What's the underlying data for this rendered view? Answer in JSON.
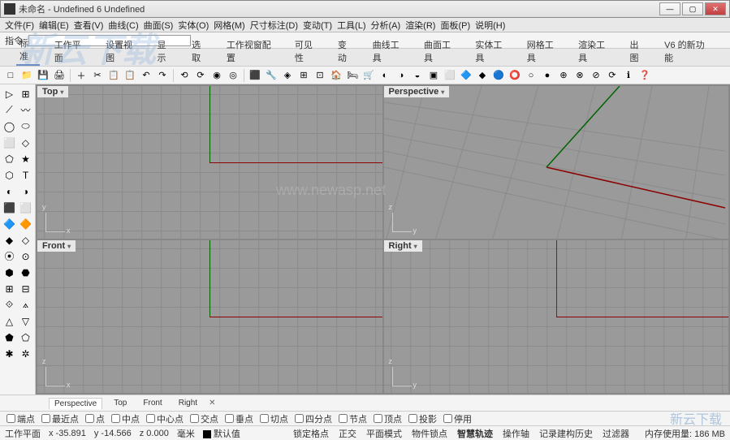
{
  "title": "未命名 - Undefined 6 Undefined",
  "menubar": [
    "文件(F)",
    "编辑(E)",
    "查看(V)",
    "曲线(C)",
    "曲面(S)",
    "实体(O)",
    "网格(M)",
    "尺寸标注(D)",
    "变动(T)",
    "工具(L)",
    "分析(A)",
    "渲染(R)",
    "面板(P)",
    "说明(H)"
  ],
  "command_label": "指令:",
  "tabs": [
    "标准",
    "工作平面",
    "设置视图",
    "显示",
    "选取",
    "工作视窗配置",
    "可见性",
    "变动",
    "曲线工具",
    "曲面工具",
    "实体工具",
    "网格工具",
    "渲染工具",
    "出图",
    "V6 的新功能"
  ],
  "active_tab": 0,
  "toolbar_icons": [
    "□",
    "📁",
    "💾",
    "🖨",
    "＋",
    "✂",
    "📋",
    "📋",
    "↶",
    "↷",
    "⟲",
    "⟳",
    "◉",
    "◎",
    "⬛",
    "🔧",
    "◈",
    "⊞",
    "⊡",
    "🏠",
    "🛏",
    "🛒",
    "◐",
    "◑",
    "◒",
    "▣",
    "⬜",
    "🔷",
    "◆",
    "🔵",
    "⭕",
    "○",
    "●",
    "⊕",
    "⊗",
    "⊘",
    "⟳",
    "ℹ",
    "❓"
  ],
  "left_tools": [
    "▷",
    "⊞",
    "⟋",
    "〰",
    "◯",
    "⬭",
    "⬜",
    "◇",
    "⬠",
    "★",
    "⬡",
    "T",
    "◐",
    "◑",
    "⬛",
    "⬜",
    "🔷",
    "🔶",
    "◆",
    "◇",
    "⦿",
    "⊙",
    "⬢",
    "⬣",
    "⊞",
    "⊟",
    "⟐",
    "⟑",
    "△",
    "▽",
    "⬟",
    "⬠",
    "✱",
    "✲"
  ],
  "viewports": {
    "top": {
      "label": "Top",
      "axis_v": "y",
      "axis_h": "x"
    },
    "perspective": {
      "label": "Perspective",
      "axis_v": "z",
      "axis_h": "y"
    },
    "front": {
      "label": "Front",
      "axis_v": "z",
      "axis_h": "x"
    },
    "right": {
      "label": "Right",
      "axis_v": "z",
      "axis_h": "y"
    }
  },
  "bottom_tabs": [
    "Perspective",
    "Top",
    "Front",
    "Right"
  ],
  "snap_options": [
    "端点",
    "最近点",
    "点",
    "中点",
    "中心点",
    "交点",
    "垂点",
    "切点",
    "四分点",
    "节点",
    "顶点",
    "投影",
    "停用"
  ],
  "status": {
    "plane": "工作平面",
    "x": "x -35.891",
    "y": "y -14.566",
    "z": "z 0.000",
    "unit": "毫米",
    "layer": "默认值",
    "right_items": [
      "锁定格点",
      "正交",
      "平面模式",
      "物件锁点",
      "智慧轨迹",
      "操作轴",
      "记录建构历史",
      "过滤器"
    ],
    "active_right": "智慧轨迹",
    "mem": "内存使用量: 186 MB"
  },
  "watermarks": {
    "w1": "新云下载",
    "w2": "www.newasp.net",
    "w3": "新云下载"
  }
}
